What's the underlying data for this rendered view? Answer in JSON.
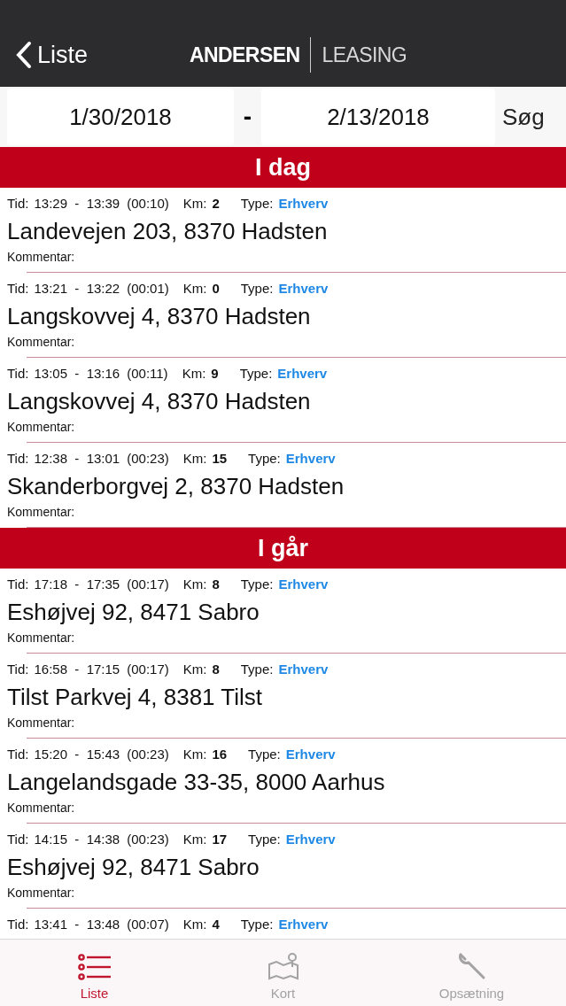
{
  "nav": {
    "back": "Liste",
    "brand_left": "ANDERSEN",
    "brand_right": "LEASING"
  },
  "filter": {
    "from": "1/30/2018",
    "separator": "-",
    "to": "2/13/2018",
    "search": "Søg"
  },
  "sections": [
    {
      "title": "I dag",
      "trips": [
        {
          "tid_label": "Tid:",
          "time": "13:29  -  13:39",
          "duration": "(00:10)",
          "km_label": "Km:",
          "km": "2",
          "type_label": "Type:",
          "type": "Erhverv",
          "address": "Landevejen 203, 8370 Hadsten",
          "comment_label": "Kommentar:"
        },
        {
          "tid_label": "Tid:",
          "time": "13:21  -  13:22",
          "duration": "(00:01)",
          "km_label": "Km:",
          "km": "0",
          "type_label": "Type:",
          "type": "Erhverv",
          "address": "Langskovvej 4, 8370 Hadsten",
          "comment_label": "Kommentar:"
        },
        {
          "tid_label": "Tid:",
          "time": "13:05  -  13:16",
          "duration": "(00:11)",
          "km_label": "Km:",
          "km": "9",
          "type_label": "Type:",
          "type": "Erhverv",
          "address": "Langskovvej 4, 8370 Hadsten",
          "comment_label": "Kommentar:"
        },
        {
          "tid_label": "Tid:",
          "time": "12:38  -  13:01",
          "duration": "(00:23)",
          "km_label": "Km:",
          "km": "15",
          "type_label": "Type:",
          "type": "Erhverv",
          "address": "Skanderborgvej 2, 8370 Hadsten",
          "comment_label": "Kommentar:"
        }
      ]
    },
    {
      "title": "I går",
      "trips": [
        {
          "tid_label": "Tid:",
          "time": "17:18  -  17:35",
          "duration": "(00:17)",
          "km_label": "Km:",
          "km": "8",
          "type_label": "Type:",
          "type": "Erhverv",
          "address": "Eshøjvej 92, 8471 Sabro",
          "comment_label": "Kommentar:"
        },
        {
          "tid_label": "Tid:",
          "time": "16:58  -  17:15",
          "duration": "(00:17)",
          "km_label": "Km:",
          "km": "8",
          "type_label": "Type:",
          "type": "Erhverv",
          "address": "Tilst Parkvej 4, 8381 Tilst",
          "comment_label": "Kommentar:"
        },
        {
          "tid_label": "Tid:",
          "time": "15:20  -  15:43",
          "duration": "(00:23)",
          "km_label": "Km:",
          "km": "16",
          "type_label": "Type:",
          "type": "Erhverv",
          "address": "Langelandsgade 33-35, 8000 Aarhus",
          "comment_label": "Kommentar:"
        },
        {
          "tid_label": "Tid:",
          "time": "14:15  -  14:38",
          "duration": "(00:23)",
          "km_label": "Km:",
          "km": "17",
          "type_label": "Type:",
          "type": "Erhverv",
          "address": "Eshøjvej 92, 8471 Sabro",
          "comment_label": "Kommentar:"
        },
        {
          "tid_label": "Tid:",
          "time": "13:41  -  13:48",
          "duration": "(00:07)",
          "km_label": "Km:",
          "km": "4",
          "type_label": "Type:",
          "type": "Erhverv"
        }
      ]
    }
  ],
  "tabs": [
    {
      "kind": "list",
      "label": "Liste",
      "selected": true
    },
    {
      "kind": "map",
      "label": "Kort",
      "selected": false
    },
    {
      "kind": "settings",
      "label": "Opsætning",
      "selected": false
    }
  ]
}
